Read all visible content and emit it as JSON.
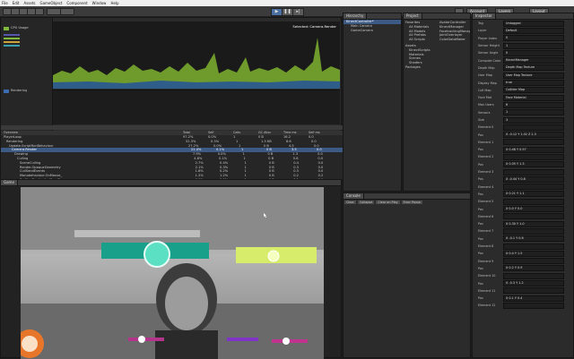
{
  "menu": [
    "File",
    "Edit",
    "Assets",
    "GameObject",
    "Component",
    "Window",
    "Help"
  ],
  "toolbar": {
    "account": "Account",
    "layers": "Layers",
    "layout": "Layout"
  },
  "profiler": {
    "selected_label": "Selected: Camera.Render",
    "modules": [
      "CPU Usage",
      "Rendering"
    ],
    "columns": [
      "Overview",
      "Total",
      "Self",
      "Calls",
      "GC Alloc",
      "Time ms",
      "Self ms"
    ],
    "rows": [
      {
        "name": "PlayerLoop",
        "total": "97.2%",
        "self": "0.0%",
        "calls": "1",
        "gc": "0 B",
        "time": "16.2",
        "selfms": "0.0"
      },
      {
        "name": "Rendering",
        "total": "52.3%",
        "self": "0.3%",
        "calls": "1",
        "gc": "1.3 KB",
        "time": "8.6",
        "selfms": "0.0"
      },
      {
        "name": "Update.ScriptRunBehaviour",
        "total": "27.2%",
        "self": "0.0%",
        "calls": "1",
        "gc": "0 B",
        "time": "4.5",
        "selfms": "0.0"
      },
      {
        "name": "Camera.Render",
        "total": "21.4%",
        "self": "0.1%",
        "calls": "1",
        "gc": "0 B",
        "time": "3.5",
        "selfms": "0.0"
      },
      {
        "name": "Drawing",
        "total": "7.9%",
        "self": "0.0%",
        "calls": "1",
        "gc": "0 B",
        "time": "1.3",
        "selfms": "0.0"
      },
      {
        "name": "Culling",
        "total": "4.8%",
        "self": "0.1%",
        "calls": "1",
        "gc": "0 B",
        "time": "0.8",
        "selfms": "0.0"
      },
      {
        "name": "SceneCulling",
        "total": "2.7%",
        "self": "0.4%",
        "calls": "1",
        "gc": "0 B",
        "time": "0.4",
        "selfms": "0.0"
      },
      {
        "name": "Render.OpaqueGeometry",
        "total": "2.1%",
        "self": "0.3%",
        "calls": "1",
        "gc": "0 B",
        "time": "0.3",
        "selfms": "0.0"
      },
      {
        "name": "CullSendEvents",
        "total": "1.8%",
        "self": "0.2%",
        "calls": "1",
        "gc": "0 B",
        "time": "0.3",
        "selfms": "0.0"
      },
      {
        "name": "Monobehaviour.OnMouse_",
        "total": "1.2%",
        "self": "1.2%",
        "calls": "1",
        "gc": "0 B",
        "time": "0.2",
        "selfms": "0.2"
      },
      {
        "name": "Profiler.FinalizeAndSendFrame",
        "total": "0.9%",
        "self": "0.9%",
        "calls": "1",
        "gc": "0 B",
        "time": "0.1",
        "selfms": "0.1"
      }
    ]
  },
  "hierarchy": {
    "tab": "Hierarchy",
    "items": [
      "KinectController*",
      "Main Camera",
      "GameCamera"
    ]
  },
  "project": {
    "tab": "Project",
    "favorites": [
      "Favorites",
      "All Materials",
      "All Models",
      "All Prefabs",
      "All Scripts"
    ],
    "folders": [
      "Assets",
      "KinectScripts",
      "Materials",
      "Scenes",
      "Shaders",
      "Packages"
    ],
    "files": [
      "AvatarController",
      "KinectManager",
      "FacetrackingManager",
      "JointOverlayer",
      "ColorDataMaker"
    ]
  },
  "inspector": {
    "tab": "Inspector",
    "fields": [
      {
        "k": "Tag",
        "v": "Untagged"
      },
      {
        "k": "Layer",
        "v": "Default"
      },
      {
        "k": "Player Index",
        "v": "0"
      },
      {
        "k": "Sensor Height",
        "v": "1"
      },
      {
        "k": "Sensor Angle",
        "v": "0"
      },
      {
        "k": "Compute Color",
        "v": "KinectManager"
      },
      {
        "k": "Depth Map",
        "v": "Depth Map Texture"
      },
      {
        "k": "User Map",
        "v": "User Map Texture"
      },
      {
        "k": "Display Map",
        "v": "true"
      },
      {
        "k": "Coll Map",
        "v": "Collider Map"
      },
      {
        "k": "Face Mat",
        "v": "Face Material"
      },
      {
        "k": "Max Users",
        "v": "6"
      },
      {
        "k": "Sensors",
        "v": "1"
      },
      {
        "k": "Size",
        "v": "3"
      },
      {
        "k": "Element 0",
        "v": ""
      },
      {
        "k": "Pos",
        "v": "X -0.12 Y 1.02 Z 2.3"
      },
      {
        "k": "Element 1",
        "v": ""
      },
      {
        "k": "Pos",
        "v": "X 0.48 Y 0.97"
      },
      {
        "k": "Element 2",
        "v": ""
      },
      {
        "k": "Pos",
        "v": "X 0.05 Y 1.3"
      },
      {
        "k": "Element 3",
        "v": ""
      },
      {
        "k": "Pos",
        "v": "X -0.44 Y 0.8"
      },
      {
        "k": "Element 4",
        "v": ""
      },
      {
        "k": "Pos",
        "v": "X 0.21 Y 1.1"
      },
      {
        "k": "Element 5",
        "v": ""
      },
      {
        "k": "Pos",
        "v": "X 0.0 Y 0.0"
      },
      {
        "k": "Element 6",
        "v": ""
      },
      {
        "k": "Pos",
        "v": "X 0.30 Y 1.0"
      },
      {
        "k": "Element 7",
        "v": ""
      },
      {
        "k": "Pos",
        "v": "X -0.1 Y 0.6"
      },
      {
        "k": "Element 8",
        "v": ""
      },
      {
        "k": "Pos",
        "v": "X 0.4 Y 1.5"
      },
      {
        "k": "Element 9",
        "v": ""
      },
      {
        "k": "Pos",
        "v": "X 0.2 Y 0.9"
      },
      {
        "k": "Element 10",
        "v": ""
      },
      {
        "k": "Pos",
        "v": "X -0.3 Y 1.2"
      },
      {
        "k": "Element 11",
        "v": ""
      },
      {
        "k": "Pos",
        "v": "X 0.1 Y 0.4"
      },
      {
        "k": "Element 12",
        "v": ""
      }
    ]
  },
  "game": {
    "tab": "Game"
  },
  "console": {
    "tab": "Console",
    "buttons": [
      "Clear",
      "Collapse",
      "Clear on Play",
      "Error Pause"
    ]
  }
}
